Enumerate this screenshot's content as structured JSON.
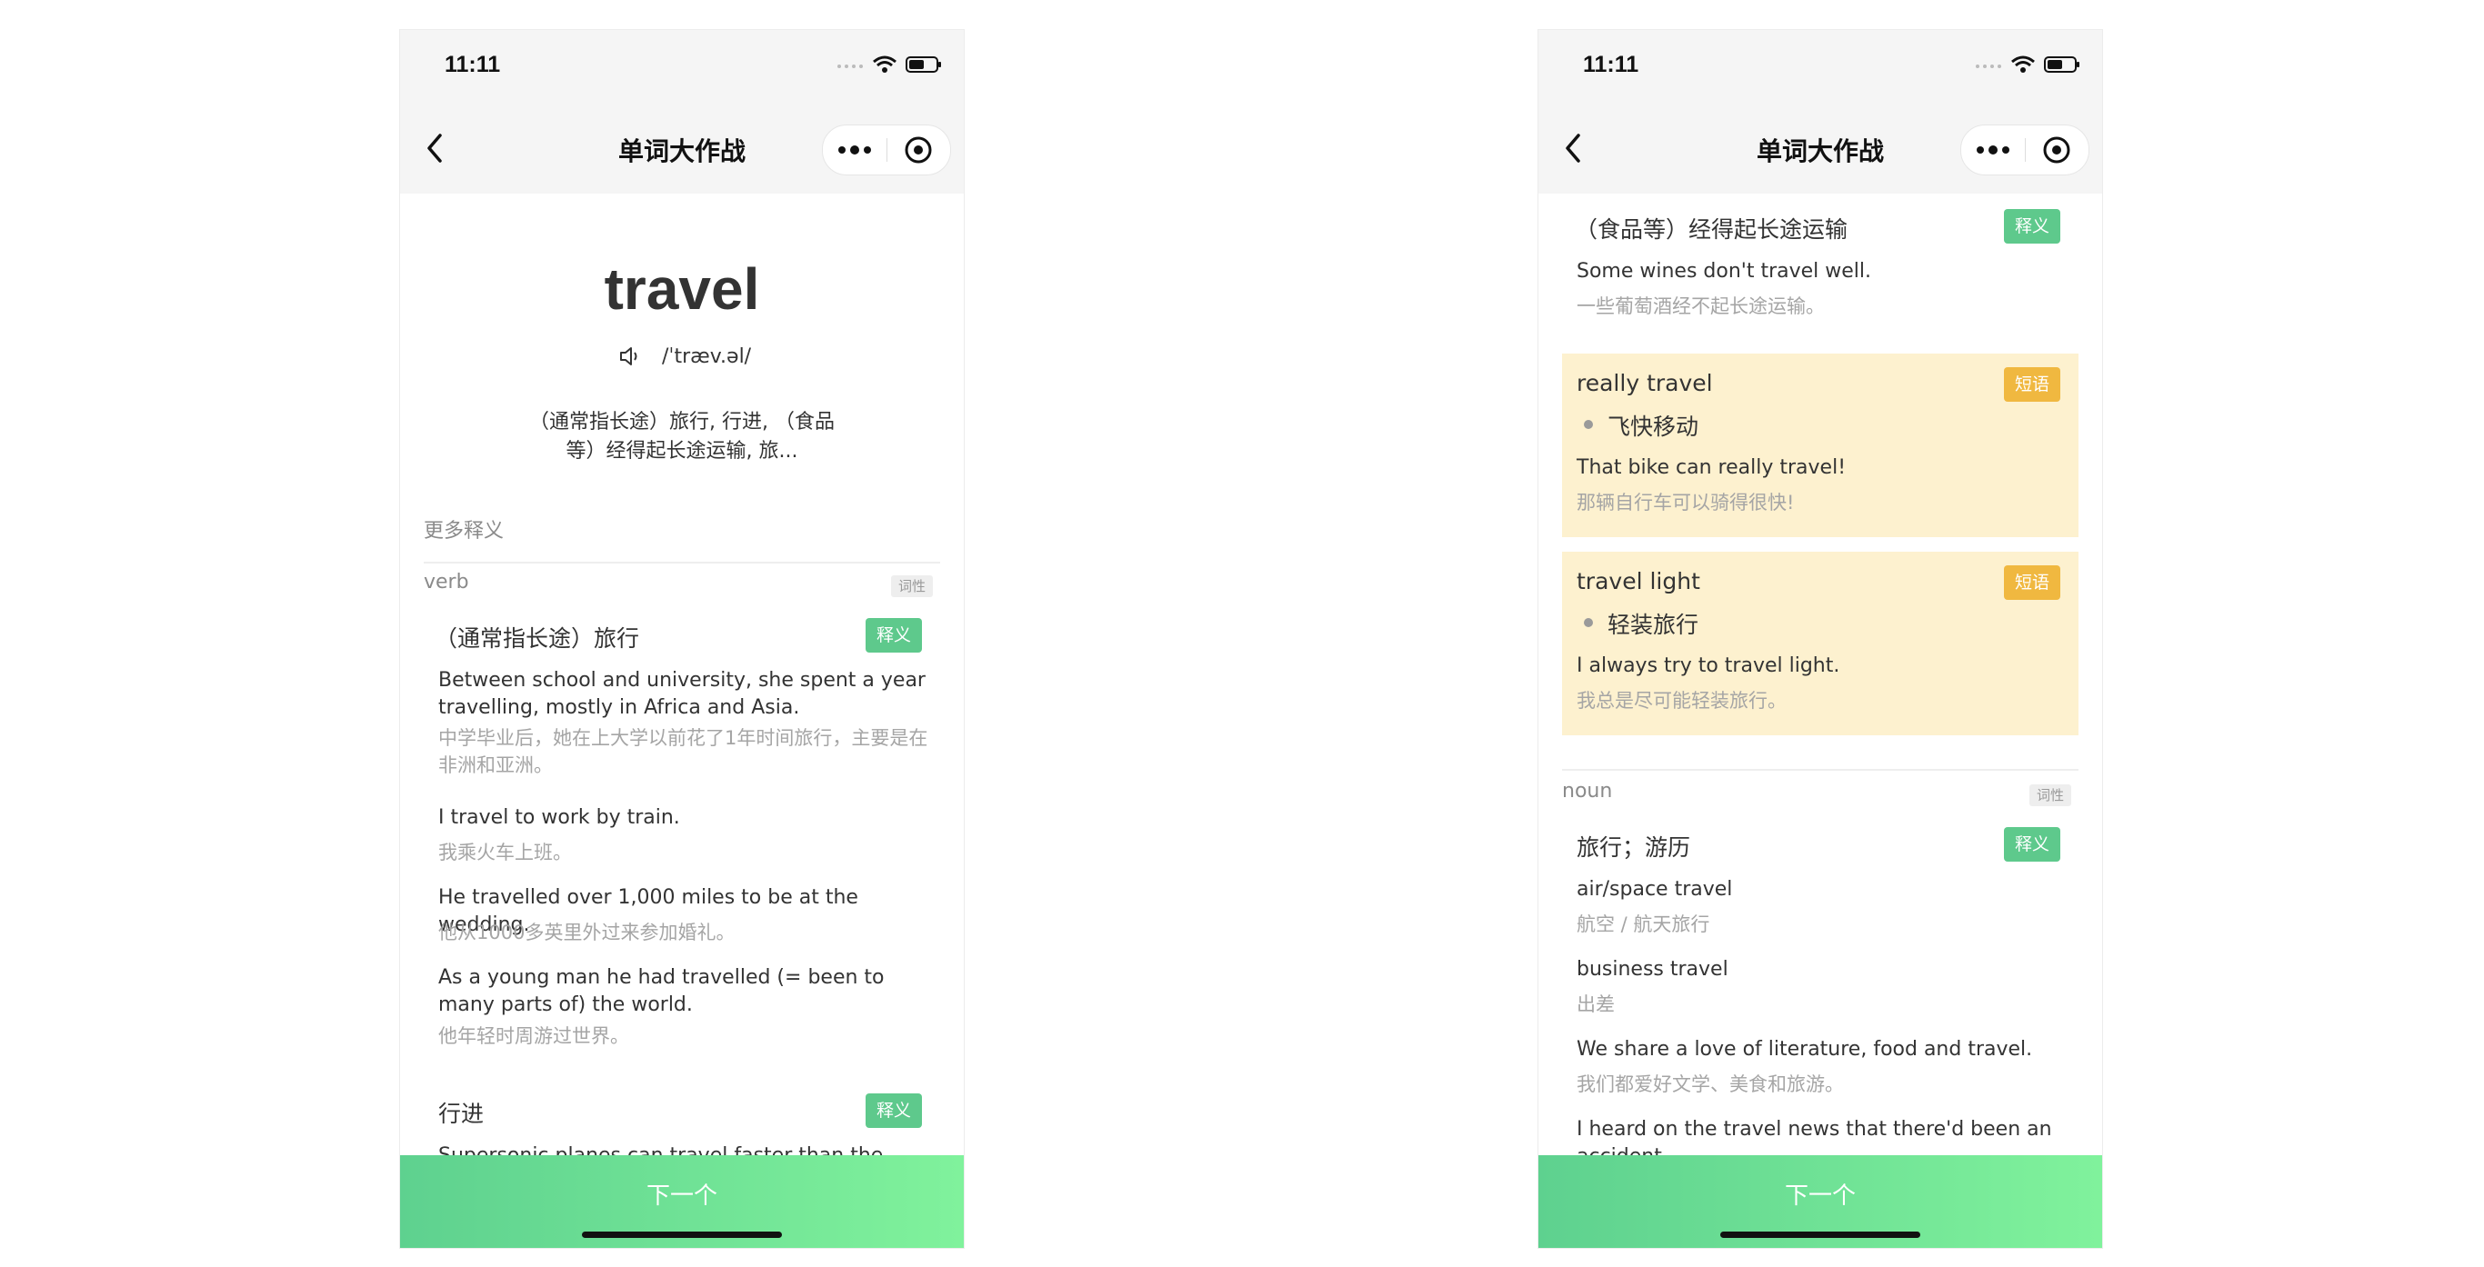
{
  "status_bar": {
    "time": "11:11"
  },
  "nav": {
    "title": "单词大作战"
  },
  "left": {
    "word": "travel",
    "phonetic": "/ˈtræv.əl/",
    "summary_line1": "（通常指长途）旅行, 行进, （食品",
    "summary_line2": "等）经得起长途运输, 旅...",
    "more_meanings": "更多释义",
    "pos": "verb",
    "pos_tag": "词性",
    "sense1": {
      "definition": "（通常指长途）旅行",
      "tag": "释义",
      "examples": [
        {
          "en": "Between school and university, she spent a year travelling, mostly in Africa and Asia.",
          "zh": "中学毕业后，她在上大学以前花了1年时间旅行，主要是在非洲和亚洲。"
        },
        {
          "en": "I travel to work by train.",
          "zh": "我乘火车上班。"
        },
        {
          "en": "He travelled over 1,000 miles to be at the wedding.",
          "zh": "他从1000多英里外过来参加婚礼。"
        },
        {
          "en": "As a young man he had travelled (= been to many parts of) the world.",
          "zh": "他年轻时周游过世界。"
        }
      ]
    },
    "sense2": {
      "definition": "行进",
      "tag": "释义",
      "example_en": "Supersonic planes can travel faster than the speed of sound."
    }
  },
  "right": {
    "sense_top": {
      "definition": "（食品等）经得起长途运输",
      "tag": "释义",
      "en": "Some wines don't travel well.",
      "zh": "一些葡萄酒经不起长途运输。"
    },
    "phrases": [
      {
        "title": "really travel",
        "tag": "短语",
        "meaning": "飞快移动",
        "en": "That bike can really travel!",
        "zh": "那辆自行车可以骑得很快!"
      },
      {
        "title": "travel light",
        "tag": "短语",
        "meaning": "轻装旅行",
        "en": "I always try to travel light.",
        "zh": "我总是尽可能轻装旅行。"
      }
    ],
    "pos": "noun",
    "pos_tag": "词性",
    "sense_noun": {
      "definition": "旅行；游历",
      "tag": "释义",
      "examples": [
        {
          "en": "air/space travel",
          "zh": "航空 / 航天旅行"
        },
        {
          "en": "business travel",
          "zh": "出差"
        },
        {
          "en": "We share a love of literature, food and travel.",
          "zh": "我们都爱好文学、美食和旅游。"
        },
        {
          "en": "I heard on the travel news that there'd been an accident."
        }
      ]
    }
  },
  "bottom": {
    "next_label": "下一个"
  },
  "colors": {
    "accent_green": "#5ec98c",
    "phrase_tag": "#f0b840",
    "phrase_bg": "#fdf1cf"
  }
}
